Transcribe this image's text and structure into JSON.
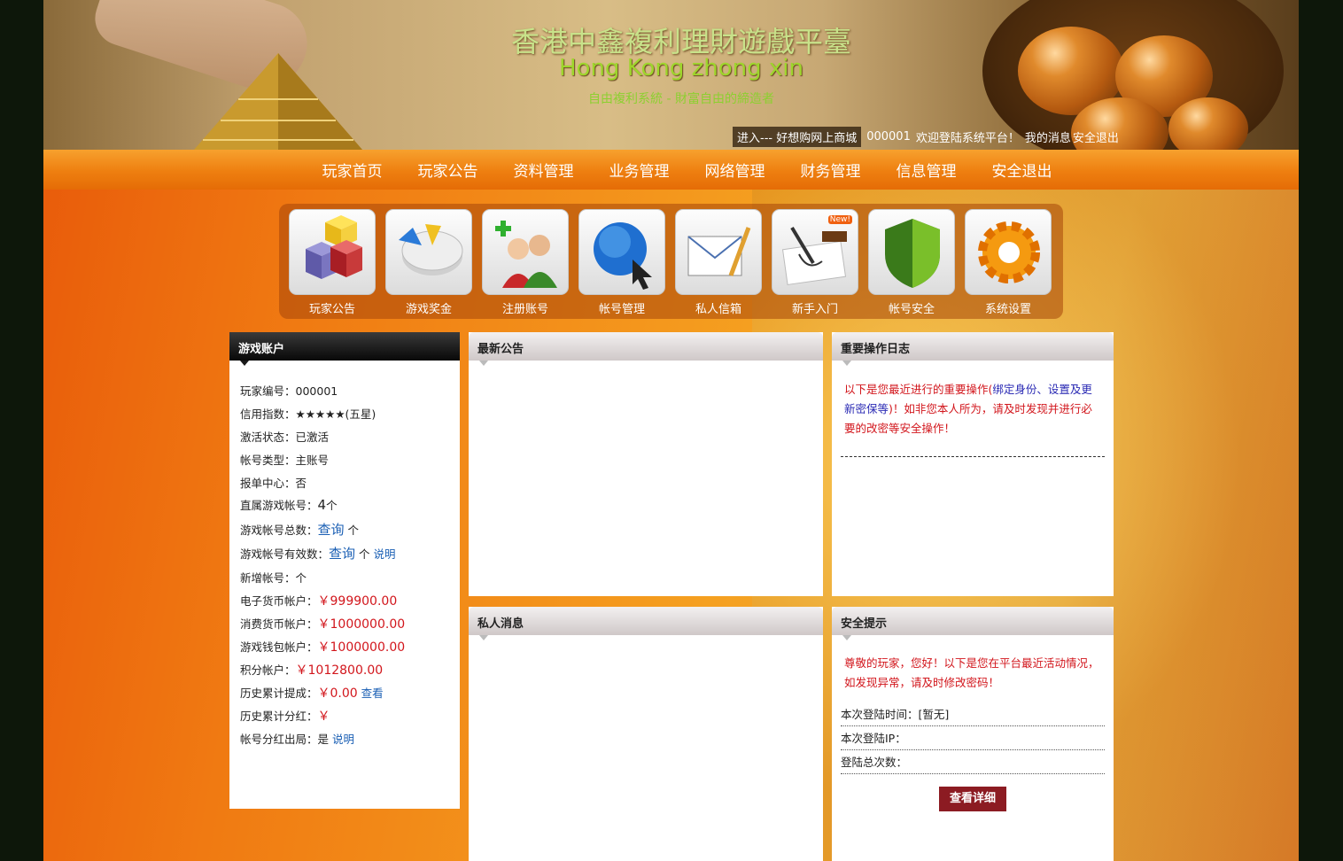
{
  "banner": {
    "title": "香港中鑫複利理財遊戲平臺",
    "subtitle": "Hong Kong zhong xin",
    "slogan": "自由複利系統 - 財富自由的締造者"
  },
  "topbar": {
    "enter": "进入--- 好想购网上商城",
    "user": "000001",
    "welcome": "欢迎登陆系统平台！",
    "messages": "我的消息",
    "logout": "安全退出"
  },
  "nav": {
    "items": [
      "玩家首页",
      "玩家公告",
      "资料管理",
      "业务管理",
      "网络管理",
      "财务管理",
      "信息管理",
      "安全退出"
    ]
  },
  "quick_icons": [
    {
      "label": "玩家公告",
      "icon": "cubes-icon"
    },
    {
      "label": "游戏奖金",
      "icon": "pie-chart-icon"
    },
    {
      "label": "注册账号",
      "icon": "add-user-icon"
    },
    {
      "label": "帐号管理",
      "icon": "globe-icon"
    },
    {
      "label": "私人信箱",
      "icon": "envelope-icon"
    },
    {
      "label": "新手入门",
      "icon": "signing-icon",
      "badge": "New!"
    },
    {
      "label": "帐号安全",
      "icon": "shield-icon"
    },
    {
      "label": "系统设置",
      "icon": "gear-icon"
    }
  ],
  "account": {
    "title": "游戏账户",
    "player_id_label": "玩家编号：",
    "player_id": "000001",
    "credit_label": "信用指数：",
    "credit": "★★★★★(五星)",
    "status_label": "激活状态：",
    "status": "已激活",
    "type_label": "帐号类型：",
    "type": "主账号",
    "center_label": "报单中心：",
    "center": "否",
    "direct_label": "直属游戏帐号：",
    "direct": "4",
    "direct_unit": "个",
    "total_label": "游戏帐号总数：",
    "total_query": "查询",
    "total_unit": "个",
    "valid_label": "游戏帐号有效数：",
    "valid_query": "查询",
    "valid_unit": "个",
    "valid_note": "说明",
    "new_label": "新增帐号：",
    "new_unit": "个",
    "ecash_label": "电子货币帐户：",
    "ecash": "￥999900.00",
    "consume_label": "消费货币帐户：",
    "consume": "￥1000000.00",
    "wallet_label": "游戏钱包帐户：",
    "wallet": "￥1000000.00",
    "points_label": "积分帐户：",
    "points": "￥1012800.00",
    "withdraw_label": "历史累计提成：",
    "withdraw": "￥0.00",
    "withdraw_link": "查看",
    "dividend_label": "历史累计分红：",
    "dividend": "￥",
    "exit_label": "帐号分红出局：",
    "exit": "是",
    "exit_link": "说明"
  },
  "notices": {
    "title": "最新公告"
  },
  "messages": {
    "title": "私人消息"
  },
  "oplog": {
    "title": "重要操作日志",
    "text_1": "以下是您最近进行的重要操作(",
    "text_blue": "绑定身份、设置及更新密保等",
    "text_2": ")！如非您本人所为，请及时发现并进行必要的改密等安全操作！"
  },
  "security": {
    "title": "安全提示",
    "message": "尊敬的玩家，您好！以下是您在平台最近活动情况，如发现异常，请及时修改密码！",
    "login_time_label": "本次登陆时间：",
    "login_time": "[暂无]",
    "login_ip_label": "本次登陆IP：",
    "login_count_label": "登陆总次数：",
    "detail_button": "查看详细"
  }
}
